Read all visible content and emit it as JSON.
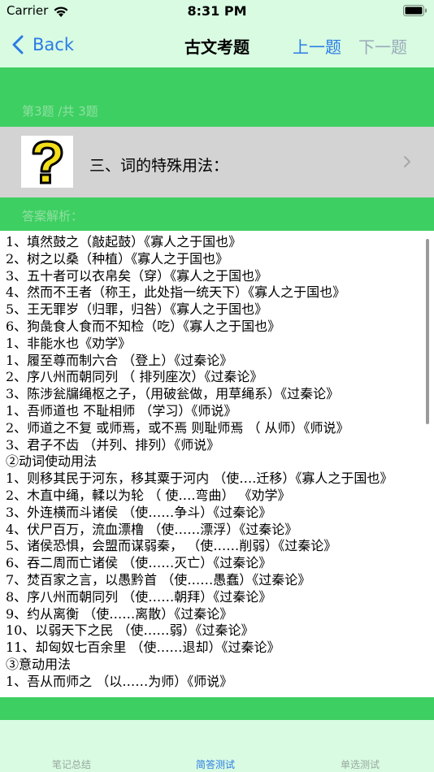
{
  "status": {
    "carrier": "Carrier",
    "time": "8:31 PM"
  },
  "nav": {
    "back_label": "Back",
    "title": "古文考题",
    "prev_label": "上一题",
    "next_label": "下一题"
  },
  "progress": {
    "text": "第3题 /共 3题"
  },
  "question": {
    "text": "三、词的特殊用法："
  },
  "answer": {
    "label": "答案解析：",
    "lines": [
      "1、填然鼓之（敲起鼓）《寡人之于国也》",
      "2、树之以桑（种植）《寡人之于国也》",
      "3、五十者可以衣帛矣（穿）《寡人之于国也》",
      "4、然而不王者（称王，此处指一统天下）《寡人之于国也》",
      "5、王无罪岁（归罪，归咎）《寡人之于国也》",
      "6、狗彘食人食而不知检（吃）《寡人之于国也》",
      "1、非能水也《劝学》",
      "1、履至尊而制六合 （登上）《过秦论》",
      "2、序八州而朝同列 （ 排列座次）《过秦论》",
      "3、陈涉瓮牖绳枢之子，（用破瓮做，用草绳系）《过秦论》",
      "1、吾师道也 不耻相师 （学习）《师说》",
      "2、师道之不复 或师焉，或不焉 则耻师焉 （ 从师）《师说》",
      "3、君子不齿 （并列、排列）《师说》",
      "②动词使动用法",
      "1、则移其民于河东，移其粟于河内 （使….迁移）《寡人之于国也》",
      "2、木直中绳，輮以为轮 （ 使….弯曲） 《劝学》",
      "3、外连横而斗诸侯 （使……争斗）《过秦论》",
      "4、伏尸百万，流血漂橹 （使……漂浮）《过秦论》",
      "5、诸侯恐惧，会盟而谋弱秦， （使……削弱）《过秦论》",
      "6、吞二周而亡诸侯 （使……灭亡）《过秦论》",
      "7、焚百家之言，以愚黔首 （使……愚蠢）《过秦论》",
      "8、序八州而朝同列 （使……朝拜）《过秦论》",
      "9、约从离衡 （使……离散）《过秦论》",
      "10、以弱天下之民 （使……弱）《过秦论》",
      "11、却匈奴七百余里 （使……退却）《过秦论》",
      "③意动用法",
      "1、吾从而师之 （以……为师）《师说》"
    ]
  },
  "tabs": [
    {
      "label": "笔记总结"
    },
    {
      "label": "简答测试"
    },
    {
      "label": "单选测试"
    }
  ],
  "colors": {
    "accent": "#2c7be5",
    "green": "#3ecf62",
    "background": "#d8fbe2"
  }
}
